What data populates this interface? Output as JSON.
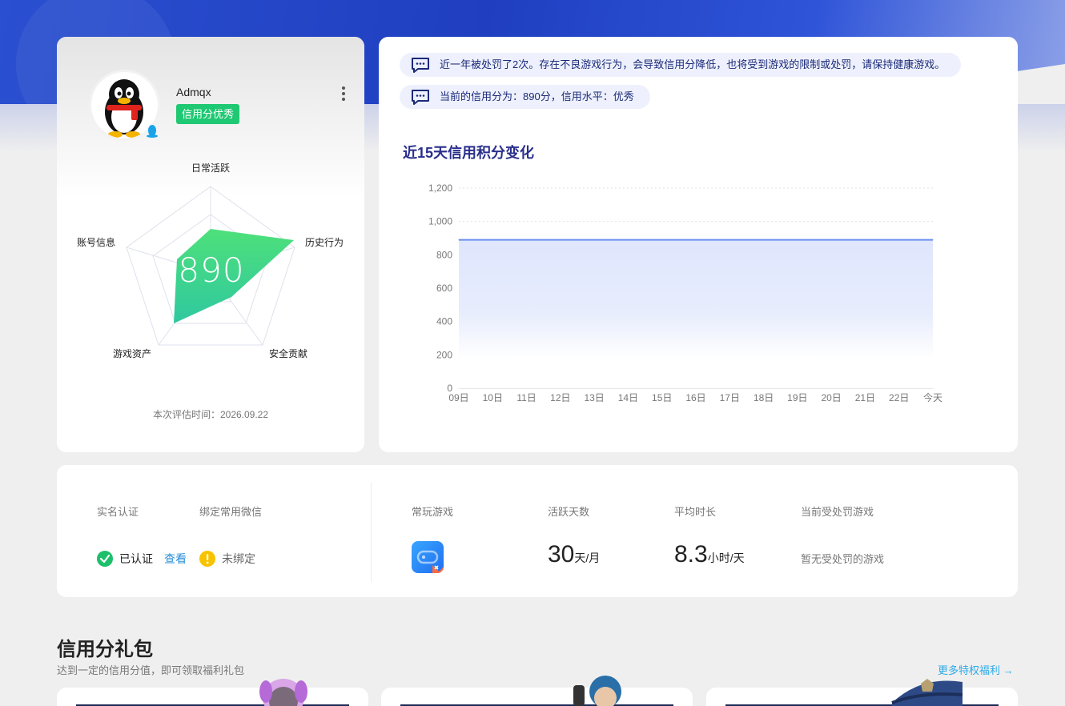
{
  "profile": {
    "username": "Admqx",
    "credit_badge": "信用分优秀",
    "score": "890",
    "radar_labels": {
      "daily": "日常活跃",
      "history": "历史行为",
      "security": "安全贡献",
      "assets": "游戏资产",
      "account": "账号信息"
    },
    "eval_time": "本次评估时间：2026.09.22"
  },
  "notices": [
    "近一年被处罚了2次。存在不良游戏行为，会导致信用分降低，也将受到游戏的限制或处罚，请保持健康游戏。",
    "当前的信用分为：890分，信用水平：优秀"
  ],
  "chart": {
    "title": "近15天信用积分变化"
  },
  "chart_data": {
    "type": "area",
    "title": "近15天信用积分变化",
    "x": [
      "09日",
      "10日",
      "11日",
      "12日",
      "13日",
      "14日",
      "15日",
      "16日",
      "17日",
      "18日",
      "19日",
      "20日",
      "21日",
      "22日",
      "今天"
    ],
    "values": [
      890,
      890,
      890,
      890,
      890,
      890,
      890,
      890,
      890,
      890,
      890,
      890,
      890,
      890,
      890
    ],
    "ylim": [
      0,
      1200
    ],
    "yticks": [
      "0",
      "200",
      "400",
      "600",
      "800",
      "1,000",
      "1,200"
    ],
    "grid": true,
    "color": "#6b8ef0"
  },
  "info": {
    "realname_head": "实名认证",
    "wechat_head": "绑定常用微信",
    "verified_text": "已认证",
    "view_link": "查看",
    "unbound_text": "未绑定",
    "games_head": "常玩游戏",
    "active_head": "活跃天数",
    "active_value": "30",
    "active_unit": "天/月",
    "avg_head": "平均时长",
    "avg_value": "8.3",
    "avg_unit": "小时/天",
    "penalty_head": "当前受处罚游戏",
    "penalty_value": "暂无受处罚的游戏"
  },
  "gift": {
    "title": "信用分礼包",
    "subtitle": "达到一定的信用分值，即可领取福利礼包",
    "more": "更多特权福利 →"
  }
}
